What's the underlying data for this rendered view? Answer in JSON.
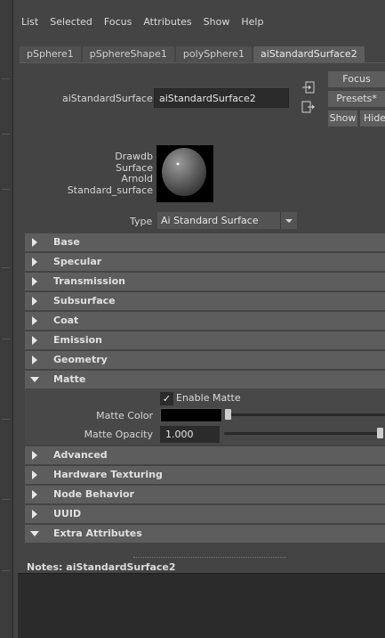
{
  "menu": [
    "List",
    "Selected",
    "Focus",
    "Attributes",
    "Show",
    "Help"
  ],
  "tabs": [
    "pSphere1",
    "pSphereShape1",
    "polySphere1",
    "aiStandardSurface2"
  ],
  "active_tab": "aiStandardSurface2",
  "node": {
    "label": "aiStandardSurface:",
    "value": "aiStandardSurface2"
  },
  "buttons": {
    "focus": "Focus",
    "presets": "Presets*",
    "show": "Show",
    "hide": "Hide"
  },
  "swatch": {
    "lines": [
      "Drawdb",
      "Surface",
      "Arnold",
      "Standard_surface"
    ]
  },
  "type": {
    "label": "Type",
    "value": "Ai Standard Surface"
  },
  "sections": [
    "Base",
    "Specular",
    "Transmission",
    "Subsurface",
    "Coat",
    "Emission",
    "Geometry",
    "Matte",
    "Advanced",
    "Hardware Texturing",
    "Node Behavior",
    "UUID",
    "Extra Attributes"
  ],
  "matte": {
    "enable_label": "Enable Matte",
    "enable_checked": true,
    "check_glyph": "✓",
    "color_label": "Matte Color",
    "color_value": "#000000",
    "opacity_label": "Matte Opacity",
    "opacity_value": "1.000"
  },
  "notes": {
    "label": "Notes:",
    "node": "aiStandardSurface2"
  }
}
